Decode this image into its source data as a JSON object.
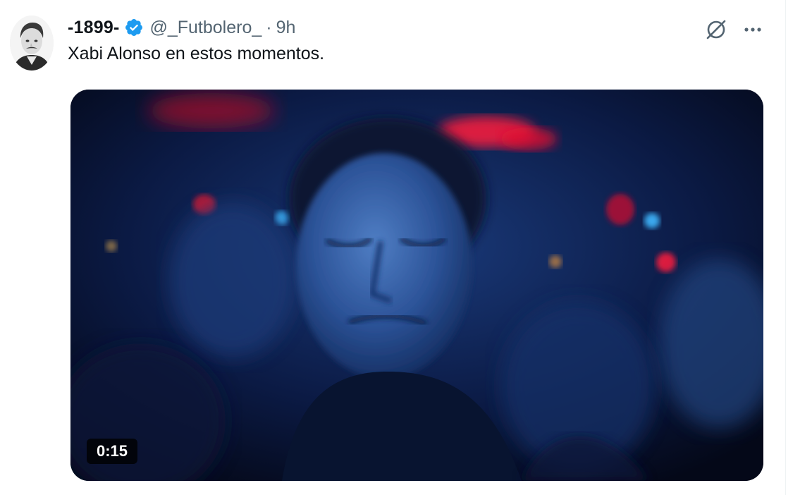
{
  "tweet": {
    "display_name": "-1899-",
    "verified_icon": "verified-badge-icon",
    "handle": "@_Futbolero_",
    "separator": "·",
    "time": "9h",
    "text": "Xabi Alonso en estos momentos.",
    "media": {
      "type": "video",
      "duration": "0:15"
    },
    "actions": {
      "grok_icon": "grok-icon",
      "more_icon": "more-dots-icon"
    }
  },
  "colors": {
    "text_primary": "#0f1419",
    "text_secondary": "#536471",
    "verified_blue": "#1d9bf0",
    "divider": "#eff3f4"
  }
}
